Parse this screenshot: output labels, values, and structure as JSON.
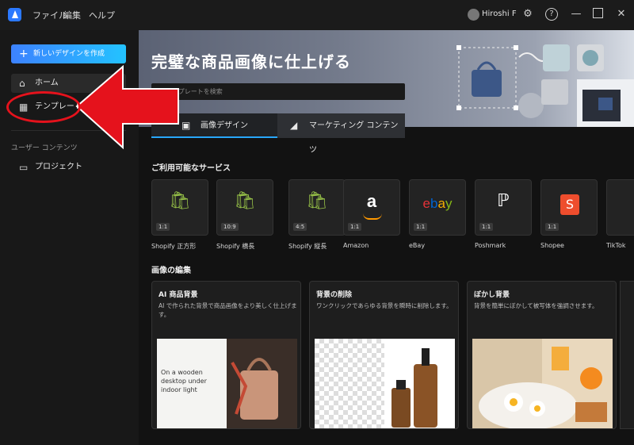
{
  "titlebar": {
    "menus": [
      "ファイル",
      "編集",
      "ヘルプ"
    ],
    "user_name": "Hiroshi F"
  },
  "sidebar": {
    "create_button": "新しいデザインを作成",
    "items": [
      {
        "label": "ホーム",
        "icon": "home-icon",
        "active": true
      },
      {
        "label": "テンプレート",
        "icon": "grid-icon",
        "active": false
      }
    ],
    "section_label": "ユーザー コンテンツ",
    "project_item": "プロジェクト"
  },
  "banner": {
    "title": "完璧な商品画像に仕上げる",
    "search_placeholder": "テンプレートを検索",
    "tabs": [
      {
        "label": "画像デザイン",
        "icon": "image-icon"
      },
      {
        "label": "マーケティング コンテンツ",
        "icon": "megaphone-icon"
      }
    ]
  },
  "services": {
    "heading": "ご利用可能なサービス",
    "items": [
      {
        "name": "Shopify 正方形",
        "ratio": "1:1",
        "icon": "shopify-icon"
      },
      {
        "name": "Shopify 横長",
        "ratio": "10:9",
        "icon": "shopify-icon"
      },
      {
        "name": "Shopify 縦長",
        "ratio": "4:5",
        "icon": "shopify-icon"
      },
      {
        "name": "Amazon",
        "ratio": "1:1",
        "icon": "amazon-icon"
      },
      {
        "name": "eBay",
        "ratio": "1:1",
        "icon": "ebay-icon"
      },
      {
        "name": "Poshmark",
        "ratio": "1:1",
        "icon": "poshmark-icon"
      },
      {
        "name": "Shopee",
        "ratio": "1:1",
        "icon": "shopee-icon"
      },
      {
        "name": "TikTok",
        "ratio": "",
        "icon": "tiktok-icon"
      }
    ]
  },
  "editing": {
    "heading": "画像の編集",
    "cards": [
      {
        "title": "AI 商品背景",
        "desc": "AI で作られた背景で商品画像をより美しく仕上げます。",
        "overlay": "On a wooden desktop under indoor light"
      },
      {
        "title": "背景の削除",
        "desc": "ワンクリックであらゆる背景を瞬時に削除します。",
        "overlay": ""
      },
      {
        "title": "ぼかし背景",
        "desc": "背景を簡単にぼかして被写体を強調させます。",
        "overlay": ""
      }
    ]
  },
  "colors": {
    "accent": "#28a7ff",
    "annotation_red": "#e5121c"
  }
}
